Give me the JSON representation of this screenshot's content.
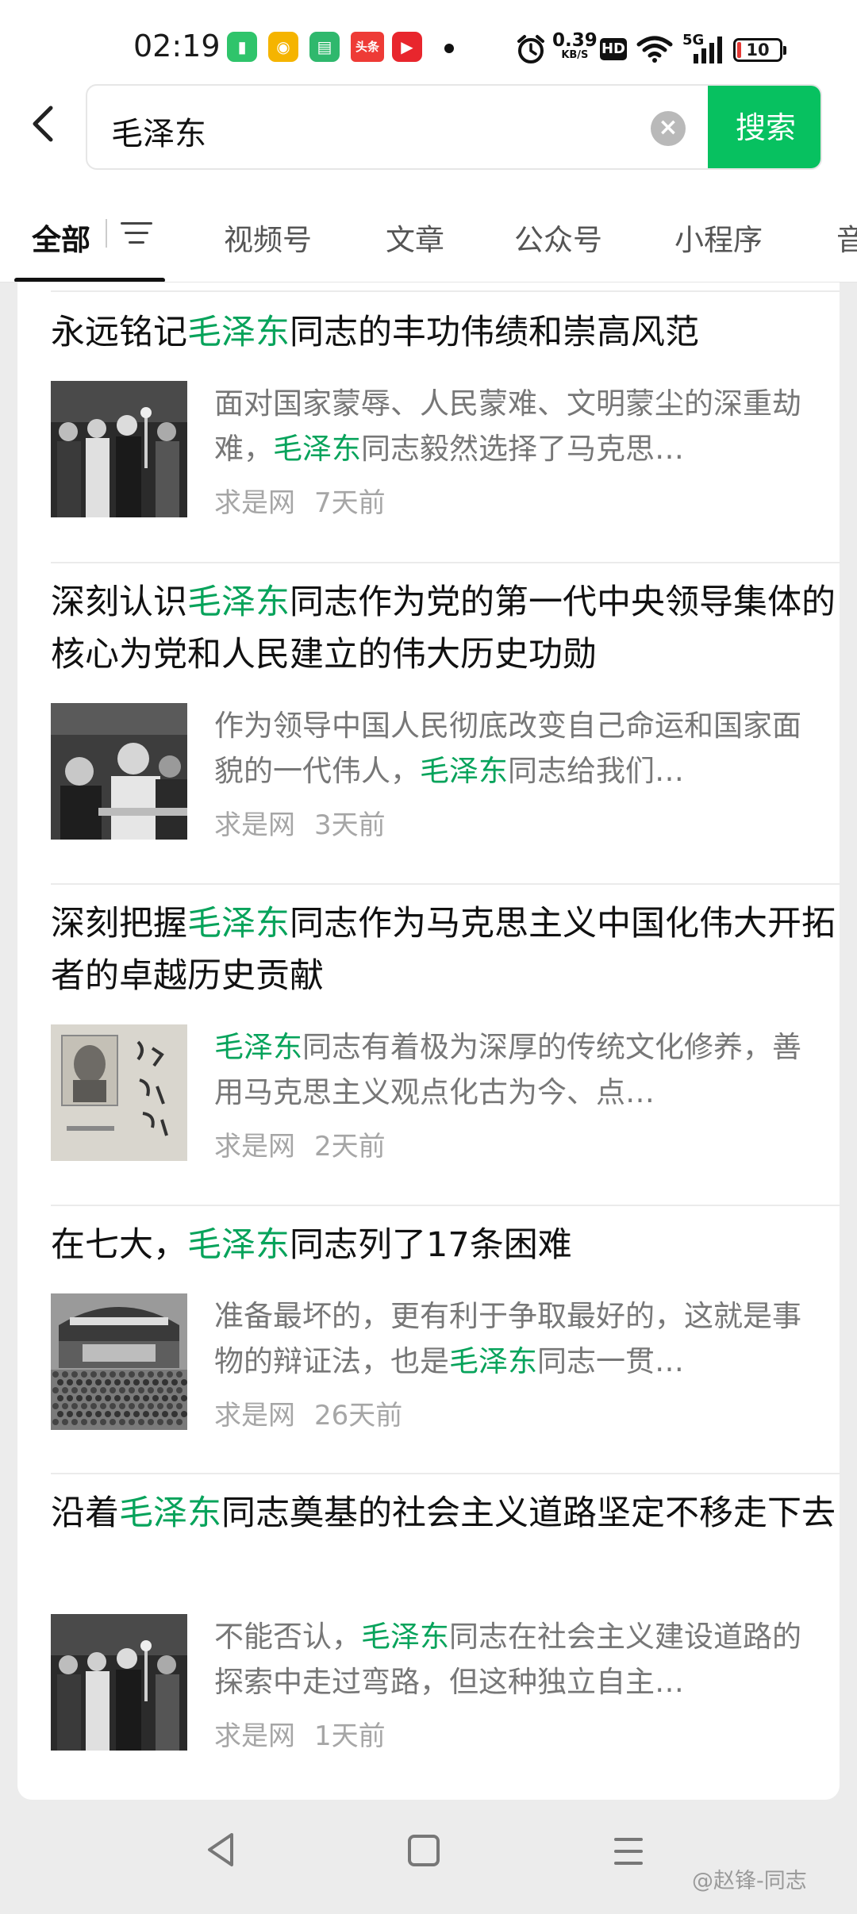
{
  "status_bar": {
    "time": "02:19",
    "speed": "0.39",
    "speed_unit": "KB/S",
    "hd": "HD",
    "network": "5G",
    "battery": "10",
    "app_icons": [
      {
        "name": "battery-manager-app-icon",
        "color": "#2fc46b",
        "glyph": "▮"
      },
      {
        "name": "weibo-app-icon",
        "color": "#f5b400",
        "glyph": "◉"
      },
      {
        "name": "messages-app-icon",
        "color": "#2fb86d",
        "glyph": "▤"
      },
      {
        "name": "toutiao-app-icon",
        "color": "#ee3b36",
        "glyph": "头条"
      },
      {
        "name": "video-app-icon",
        "color": "#e8262d",
        "glyph": "▶"
      }
    ]
  },
  "search": {
    "query": "毛泽东",
    "clear_icon": "clear-icon",
    "button_label": "搜索"
  },
  "tabs": [
    {
      "label": "全部",
      "active": true
    },
    {
      "label": "视频号",
      "active": false
    },
    {
      "label": "文章",
      "active": false
    },
    {
      "label": "公众号",
      "active": false
    },
    {
      "label": "小程序",
      "active": false
    },
    {
      "label": "音",
      "active": false
    }
  ],
  "results": [
    {
      "title": [
        {
          "t": "永远铭记"
        },
        {
          "t": "毛泽东",
          "hl": true
        },
        {
          "t": "同志的丰功伟绩和崇高风范"
        }
      ],
      "snippet": [
        {
          "t": "面对国家蒙辱、人民蒙难、文明蒙尘的深重劫难，"
        },
        {
          "t": "毛泽东",
          "hl": true
        },
        {
          "t": "同志毅然选择了马克思…"
        }
      ],
      "source": "求是网",
      "time": "7天前",
      "thumb": "black-white-speech-photo"
    },
    {
      "title": [
        {
          "t": "深刻认识"
        },
        {
          "t": "毛泽东",
          "hl": true
        },
        {
          "t": "同志作为党的第一代中央领导集体的核心为党和人民建立的伟大历史功勋"
        }
      ],
      "snippet": [
        {
          "t": "作为领导中国人民彻底改变自己命运和国家面貌的一代伟人，"
        },
        {
          "t": "毛泽东",
          "hl": true
        },
        {
          "t": "同志给我们…"
        }
      ],
      "source": "求是网",
      "time": "3天前",
      "thumb": "black-white-meeting-photo"
    },
    {
      "title": [
        {
          "t": "深刻把握"
        },
        {
          "t": "毛泽东",
          "hl": true
        },
        {
          "t": "同志作为马克思主义中国化伟大开拓者的卓越历史贡献"
        }
      ],
      "snippet": [
        {
          "t": "毛泽东",
          "hl": true
        },
        {
          "t": "同志有着极为深厚的传统文化修养，善用马克思主义观点化古为今、点…"
        }
      ],
      "source": "求是网",
      "time": "2天前",
      "thumb": "portrait-calligraphy-book-photo"
    },
    {
      "title": [
        {
          "t": "在七大，"
        },
        {
          "t": "毛泽东",
          "hl": true
        },
        {
          "t": "同志列了17条困难"
        }
      ],
      "snippet": [
        {
          "t": "准备最坏的，更有利于争取最好的，这就是事物的辩证法，也是"
        },
        {
          "t": "毛泽东",
          "hl": true
        },
        {
          "t": "同志一贯…"
        }
      ],
      "source": "求是网",
      "time": "26天前",
      "thumb": "congress-hall-photo"
    },
    {
      "title": [
        {
          "t": "沿着"
        },
        {
          "t": "毛泽东",
          "hl": true
        },
        {
          "t": "同志奠基的社会主义道路坚定不移走下去"
        }
      ],
      "snippet": [
        {
          "t": "不能否认，"
        },
        {
          "t": "毛泽东",
          "hl": true
        },
        {
          "t": "同志在社会主义建设道路的探索中走过弯路，但这种独立自主…"
        }
      ],
      "source": "求是网",
      "time": "1天前",
      "thumb": "black-white-speech-photo"
    }
  ],
  "watermark": "@赵锋-同志",
  "colors": {
    "accent": "#07c160",
    "highlight": "#07a35b",
    "secondary_text": "#777777",
    "meta_text": "#a6a6a6"
  }
}
